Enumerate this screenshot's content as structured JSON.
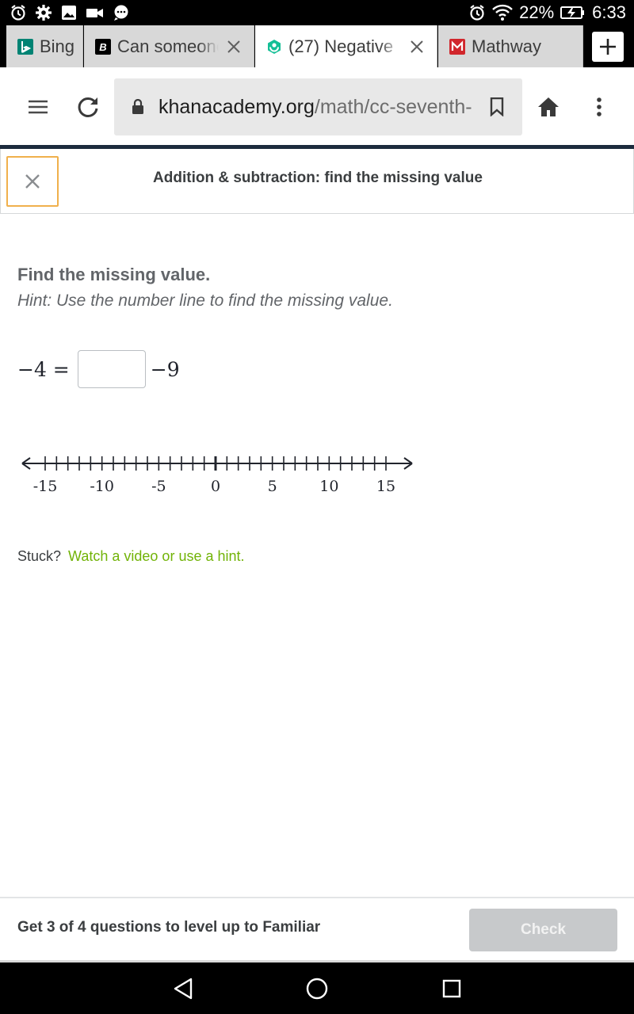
{
  "status_bar": {
    "left_icons": [
      "alarm-icon",
      "gear-icon",
      "image-icon",
      "video-icon",
      "chat-icon"
    ],
    "battery": "22%",
    "time": "6:33"
  },
  "tabs": [
    {
      "title": "Bing",
      "favicon": "bing-icon",
      "active": false
    },
    {
      "title": "Can someone",
      "favicon": "brainly-icon",
      "active": false
    },
    {
      "title": "(27) Negative",
      "favicon": "khan-icon",
      "active": true
    },
    {
      "title": "Mathway",
      "favicon": "mathway-icon",
      "active": false
    }
  ],
  "toolbar": {
    "url_domain": "khanacademy.org",
    "url_path": "/math/cc-seventh-grade-math"
  },
  "exercise": {
    "title": "Addition & subtraction: find the missing value",
    "prompt": "Find the missing value.",
    "hint": "Hint: Use the number line to find the missing value.",
    "equation_lhs": "−4 =",
    "equation_rhs": "−9",
    "answer_value": "",
    "stuck_label": "Stuck?",
    "hint_link": "Watch a video or use a hint."
  },
  "number_line": {
    "min": -15,
    "max": 15,
    "tick_step": 1,
    "labels": [
      "-15",
      "-10",
      "-5",
      "0",
      "5",
      "10",
      "15"
    ]
  },
  "footer": {
    "level_text": "Get 3 of 4 questions to level up to Familiar",
    "check_label": "Check"
  },
  "colors": {
    "accent_green": "#71b307",
    "close_border": "#f0b04c",
    "check_disabled": "#c7c9cb"
  }
}
